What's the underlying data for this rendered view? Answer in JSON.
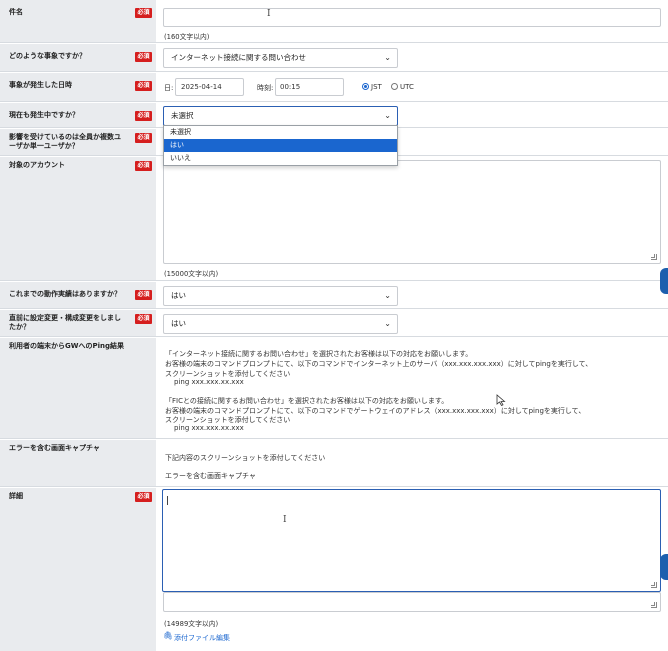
{
  "required_badge": "必須",
  "fields": {
    "subject": {
      "label": "件名",
      "note": "(160文字以内)"
    },
    "event_type": {
      "label": "どのような事象ですか？",
      "selected": "インターネット接続に関する問い合わせ"
    },
    "occurred_at": {
      "label": "事象が発生した日時",
      "date_label": "日:",
      "date_value": "2025-04-14",
      "time_label": "時刻:",
      "time_value": "00:15",
      "tz_options": [
        "JST",
        "UTC"
      ],
      "tz_selected": "JST"
    },
    "ongoing": {
      "label": "現在も発生中ですか？",
      "selected": "未選択",
      "options": [
        "未選択",
        "はい",
        "いいえ"
      ],
      "highlighted": "はい"
    },
    "scope": {
      "label": "影響を受けているのは全員か複数ユーザか単一ユーザか？"
    },
    "account": {
      "label": "対象のアカウント",
      "note": "(15000文字以内)"
    },
    "worked_before": {
      "label": "これまでの動作実績はありますか？",
      "selected": "はい"
    },
    "recent_change": {
      "label": "直前に設定変更・構成変更をしましたか？",
      "selected": "はい"
    },
    "ping": {
      "label": "利用者の端末からGWへのPing結果",
      "lines": [
        "「インターネット接続に関するお問い合わせ」を選択されたお客様は以下の対応をお願いします。",
        "お客様の端末のコマンドプロンプトにて、以下のコマンドでインターネット上のサーバ（xxx.xxx.xxx.xxx）に対してpingを実行して、",
        "スクリーンショットを添付してください",
        "ping xxx.xxx.xx.xxx",
        "「FICとの接続に関するお問い合わせ」を選択されたお客様は以下の対応をお願いします。",
        "お客様の端末のコマンドプロンプトにて、以下のコマンドでゲートウェイのアドレス（xxx.xxx.xxx.xxx）に対してpingを実行して、",
        "スクリーンショットを添付してください",
        "ping xxx.xxx.xx.xxx"
      ]
    },
    "error_capture": {
      "label": "エラーを含む画面キャプチャ",
      "line1": "下記内容のスクリーンショットを添付してください",
      "line2": "エラーを含む画面キャプチャ"
    },
    "details": {
      "label": "詳細",
      "note": "(14989文字以内)",
      "attach": "添付ファイル編集"
    }
  },
  "colors": {
    "accent": "#1a66cf",
    "required": "#d51e1e",
    "label_bg": "#e9ebee"
  },
  "icons": [
    "chevron-down-icon",
    "paperclip-icon",
    "resize-grip-icon",
    "mouse-pointer-icon",
    "text-cursor-icon"
  ]
}
